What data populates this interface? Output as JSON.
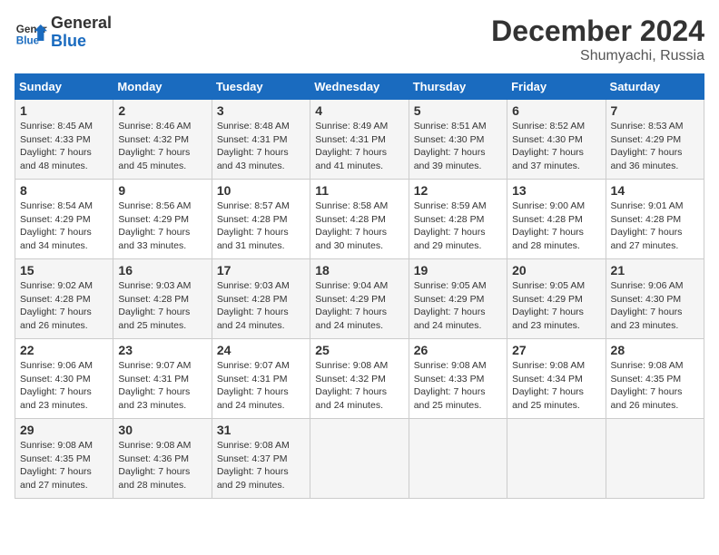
{
  "header": {
    "logo_line1": "General",
    "logo_line2": "Blue",
    "month": "December 2024",
    "location": "Shumyachi, Russia"
  },
  "weekdays": [
    "Sunday",
    "Monday",
    "Tuesday",
    "Wednesday",
    "Thursday",
    "Friday",
    "Saturday"
  ],
  "weeks": [
    [
      {
        "day": "1",
        "sunrise": "Sunrise: 8:45 AM",
        "sunset": "Sunset: 4:33 PM",
        "daylight": "Daylight: 7 hours and 48 minutes."
      },
      {
        "day": "2",
        "sunrise": "Sunrise: 8:46 AM",
        "sunset": "Sunset: 4:32 PM",
        "daylight": "Daylight: 7 hours and 45 minutes."
      },
      {
        "day": "3",
        "sunrise": "Sunrise: 8:48 AM",
        "sunset": "Sunset: 4:31 PM",
        "daylight": "Daylight: 7 hours and 43 minutes."
      },
      {
        "day": "4",
        "sunrise": "Sunrise: 8:49 AM",
        "sunset": "Sunset: 4:31 PM",
        "daylight": "Daylight: 7 hours and 41 minutes."
      },
      {
        "day": "5",
        "sunrise": "Sunrise: 8:51 AM",
        "sunset": "Sunset: 4:30 PM",
        "daylight": "Daylight: 7 hours and 39 minutes."
      },
      {
        "day": "6",
        "sunrise": "Sunrise: 8:52 AM",
        "sunset": "Sunset: 4:30 PM",
        "daylight": "Daylight: 7 hours and 37 minutes."
      },
      {
        "day": "7",
        "sunrise": "Sunrise: 8:53 AM",
        "sunset": "Sunset: 4:29 PM",
        "daylight": "Daylight: 7 hours and 36 minutes."
      }
    ],
    [
      {
        "day": "8",
        "sunrise": "Sunrise: 8:54 AM",
        "sunset": "Sunset: 4:29 PM",
        "daylight": "Daylight: 7 hours and 34 minutes."
      },
      {
        "day": "9",
        "sunrise": "Sunrise: 8:56 AM",
        "sunset": "Sunset: 4:29 PM",
        "daylight": "Daylight: 7 hours and 33 minutes."
      },
      {
        "day": "10",
        "sunrise": "Sunrise: 8:57 AM",
        "sunset": "Sunset: 4:28 PM",
        "daylight": "Daylight: 7 hours and 31 minutes."
      },
      {
        "day": "11",
        "sunrise": "Sunrise: 8:58 AM",
        "sunset": "Sunset: 4:28 PM",
        "daylight": "Daylight: 7 hours and 30 minutes."
      },
      {
        "day": "12",
        "sunrise": "Sunrise: 8:59 AM",
        "sunset": "Sunset: 4:28 PM",
        "daylight": "Daylight: 7 hours and 29 minutes."
      },
      {
        "day": "13",
        "sunrise": "Sunrise: 9:00 AM",
        "sunset": "Sunset: 4:28 PM",
        "daylight": "Daylight: 7 hours and 28 minutes."
      },
      {
        "day": "14",
        "sunrise": "Sunrise: 9:01 AM",
        "sunset": "Sunset: 4:28 PM",
        "daylight": "Daylight: 7 hours and 27 minutes."
      }
    ],
    [
      {
        "day": "15",
        "sunrise": "Sunrise: 9:02 AM",
        "sunset": "Sunset: 4:28 PM",
        "daylight": "Daylight: 7 hours and 26 minutes."
      },
      {
        "day": "16",
        "sunrise": "Sunrise: 9:03 AM",
        "sunset": "Sunset: 4:28 PM",
        "daylight": "Daylight: 7 hours and 25 minutes."
      },
      {
        "day": "17",
        "sunrise": "Sunrise: 9:03 AM",
        "sunset": "Sunset: 4:28 PM",
        "daylight": "Daylight: 7 hours and 24 minutes."
      },
      {
        "day": "18",
        "sunrise": "Sunrise: 9:04 AM",
        "sunset": "Sunset: 4:29 PM",
        "daylight": "Daylight: 7 hours and 24 minutes."
      },
      {
        "day": "19",
        "sunrise": "Sunrise: 9:05 AM",
        "sunset": "Sunset: 4:29 PM",
        "daylight": "Daylight: 7 hours and 24 minutes."
      },
      {
        "day": "20",
        "sunrise": "Sunrise: 9:05 AM",
        "sunset": "Sunset: 4:29 PM",
        "daylight": "Daylight: 7 hours and 23 minutes."
      },
      {
        "day": "21",
        "sunrise": "Sunrise: 9:06 AM",
        "sunset": "Sunset: 4:30 PM",
        "daylight": "Daylight: 7 hours and 23 minutes."
      }
    ],
    [
      {
        "day": "22",
        "sunrise": "Sunrise: 9:06 AM",
        "sunset": "Sunset: 4:30 PM",
        "daylight": "Daylight: 7 hours and 23 minutes."
      },
      {
        "day": "23",
        "sunrise": "Sunrise: 9:07 AM",
        "sunset": "Sunset: 4:31 PM",
        "daylight": "Daylight: 7 hours and 23 minutes."
      },
      {
        "day": "24",
        "sunrise": "Sunrise: 9:07 AM",
        "sunset": "Sunset: 4:31 PM",
        "daylight": "Daylight: 7 hours and 24 minutes."
      },
      {
        "day": "25",
        "sunrise": "Sunrise: 9:08 AM",
        "sunset": "Sunset: 4:32 PM",
        "daylight": "Daylight: 7 hours and 24 minutes."
      },
      {
        "day": "26",
        "sunrise": "Sunrise: 9:08 AM",
        "sunset": "Sunset: 4:33 PM",
        "daylight": "Daylight: 7 hours and 25 minutes."
      },
      {
        "day": "27",
        "sunrise": "Sunrise: 9:08 AM",
        "sunset": "Sunset: 4:34 PM",
        "daylight": "Daylight: 7 hours and 25 minutes."
      },
      {
        "day": "28",
        "sunrise": "Sunrise: 9:08 AM",
        "sunset": "Sunset: 4:35 PM",
        "daylight": "Daylight: 7 hours and 26 minutes."
      }
    ],
    [
      {
        "day": "29",
        "sunrise": "Sunrise: 9:08 AM",
        "sunset": "Sunset: 4:35 PM",
        "daylight": "Daylight: 7 hours and 27 minutes."
      },
      {
        "day": "30",
        "sunrise": "Sunrise: 9:08 AM",
        "sunset": "Sunset: 4:36 PM",
        "daylight": "Daylight: 7 hours and 28 minutes."
      },
      {
        "day": "31",
        "sunrise": "Sunrise: 9:08 AM",
        "sunset": "Sunset: 4:37 PM",
        "daylight": "Daylight: 7 hours and 29 minutes."
      },
      null,
      null,
      null,
      null
    ]
  ]
}
